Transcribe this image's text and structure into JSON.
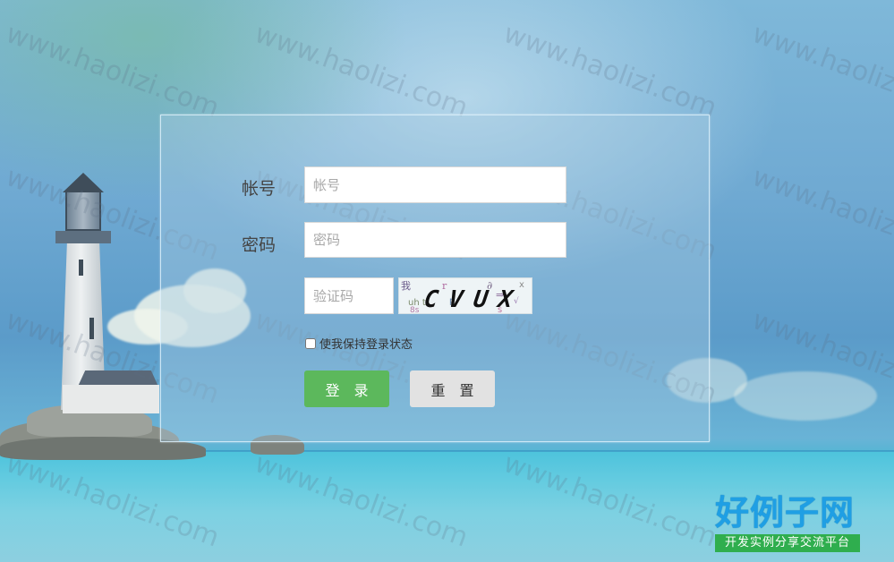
{
  "watermark": {
    "text": "www.haolizi.com"
  },
  "login_form": {
    "account_label": "帐号",
    "account_placeholder": "帐号",
    "password_label": "密码",
    "password_placeholder": "密码",
    "captcha_placeholder": "验证码",
    "captcha_text": "CVUX",
    "remember_label": "使我保持登录状态",
    "remember_checked": false,
    "login_button": "登录",
    "reset_button": "重置"
  },
  "logo": {
    "main_text": "好例子网",
    "sub_text": "开发实例分享交流平台"
  },
  "colors": {
    "login_button": "#5cb85c",
    "reset_button": "#e2e2e2",
    "logo_blue": "#1f9fe4",
    "logo_green": "#2fae4e"
  }
}
